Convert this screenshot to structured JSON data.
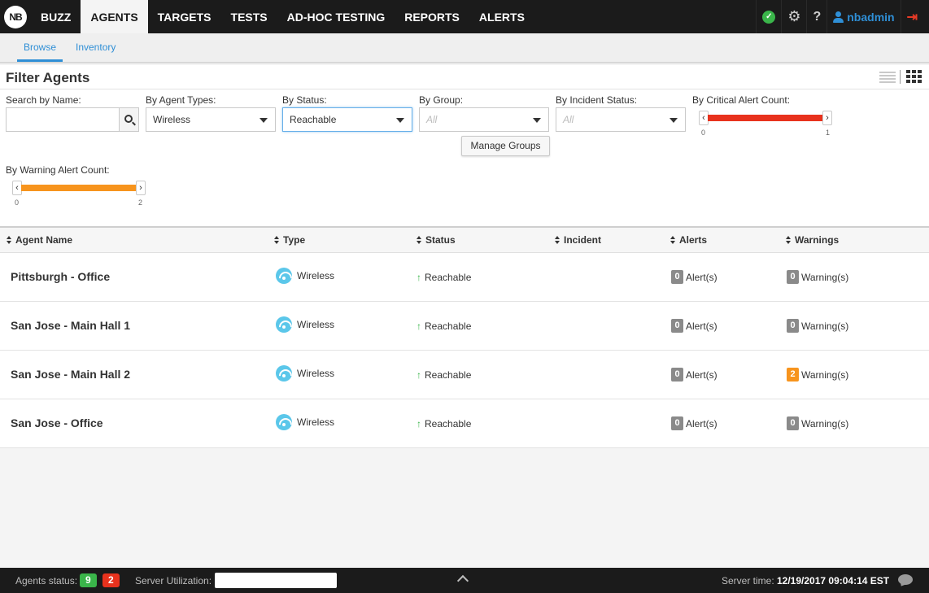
{
  "app": {
    "logo_text": "NB"
  },
  "nav": {
    "items": [
      {
        "label": "BUZZ"
      },
      {
        "label": "AGENTS"
      },
      {
        "label": "TARGETS"
      },
      {
        "label": "TESTS"
      },
      {
        "label": "AD-HOC TESTING"
      },
      {
        "label": "REPORTS"
      },
      {
        "label": "ALERTS"
      }
    ],
    "active": "AGENTS",
    "status_icon": "check-circle-icon",
    "status_glyph": "✓",
    "settings_glyph": "⚙",
    "help_glyph": "?",
    "username": "nbadmin",
    "logout_glyph": "⇥"
  },
  "subnav": {
    "tabs": [
      {
        "label": "Browse"
      },
      {
        "label": "Inventory"
      }
    ],
    "active": "Browse"
  },
  "filters": {
    "title": "Filter Agents",
    "search": {
      "label": "Search by Name:",
      "value": "",
      "placeholder": ""
    },
    "agent_types": {
      "label": "By Agent Types:",
      "value": "Wireless"
    },
    "status": {
      "label": "By Status:",
      "value": "Reachable"
    },
    "group": {
      "label": "By Group:",
      "placeholder": "All"
    },
    "incident_status": {
      "label": "By Incident Status:",
      "placeholder": "All"
    },
    "manage_groups_label": "Manage Groups",
    "critical_alert_count": {
      "label": "By Critical Alert Count:",
      "min": "0",
      "max": "1",
      "color": "#e8321d"
    },
    "warning_alert_count": {
      "label": "By Warning Alert Count:",
      "min": "0",
      "max": "2",
      "color": "#f7941d"
    }
  },
  "table": {
    "columns": [
      "Agent Name",
      "Type",
      "Status",
      "Incident",
      "Alerts",
      "Warnings"
    ],
    "rows": [
      {
        "name": "Pittsburgh - Office",
        "type": "Wireless",
        "status": "Reachable",
        "alerts": "0",
        "alerts_label": "Alert(s)",
        "warnings": "0",
        "warnings_label": "Warning(s)"
      },
      {
        "name": "San Jose - Main Hall 1",
        "type": "Wireless",
        "status": "Reachable",
        "alerts": "0",
        "alerts_label": "Alert(s)",
        "warnings": "0",
        "warnings_label": "Warning(s)"
      },
      {
        "name": "San Jose - Main Hall 2",
        "type": "Wireless",
        "status": "Reachable",
        "alerts": "0",
        "alerts_label": "Alert(s)",
        "warnings": "2",
        "warnings_label": "Warning(s)"
      },
      {
        "name": "San Jose - Office",
        "type": "Wireless",
        "status": "Reachable",
        "alerts": "0",
        "alerts_label": "Alert(s)",
        "warnings": "0",
        "warnings_label": "Warning(s)"
      }
    ]
  },
  "footer": {
    "agents_status_label": "Agents status:",
    "agents_up": "9",
    "agents_down": "2",
    "server_utilization_label": "Server Utilization:",
    "server_time_label": "Server time:",
    "server_time": "12/19/2017 09:04:14 EST"
  },
  "colors": {
    "accent": "#2f8fd6",
    "nav_bg": "#1b1b1b",
    "ok": "#3ab54a",
    "danger": "#e8321d",
    "warning": "#f7941d"
  }
}
